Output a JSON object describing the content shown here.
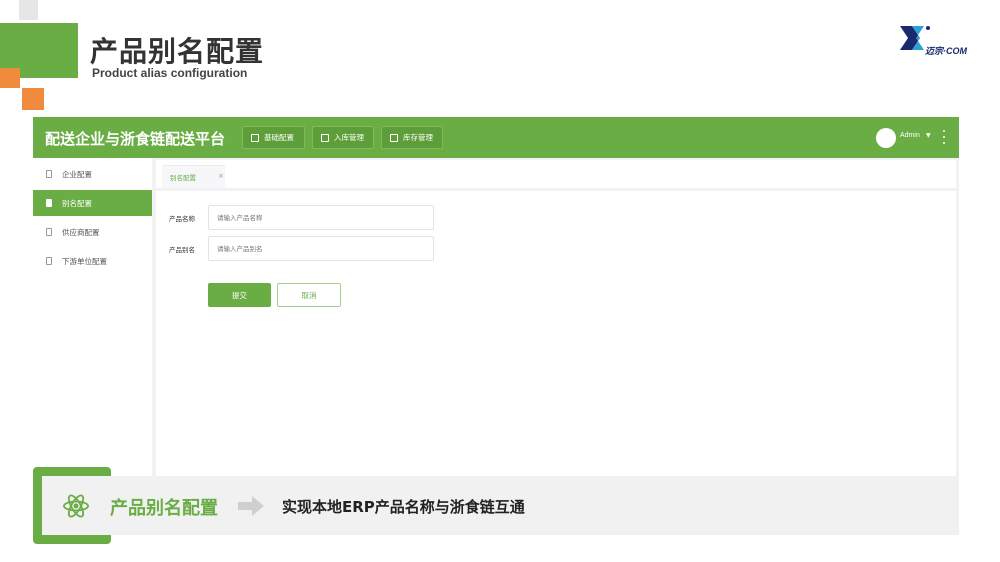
{
  "slide": {
    "title": "产品别名配置",
    "subtitle": "Product alias configuration",
    "logo_text": "迈宗·COM"
  },
  "app": {
    "title": "配送企业与浙食链配送平台",
    "nav": [
      {
        "label": "基础配置",
        "icon": "document-icon"
      },
      {
        "label": "入库管理",
        "icon": "inbox-icon"
      },
      {
        "label": "库存管理",
        "icon": "box-icon"
      }
    ],
    "user": {
      "name": "Admin",
      "caret": "▼"
    },
    "sidebar": [
      {
        "label": "企业配置",
        "active": false
      },
      {
        "label": "别名配置",
        "active": true
      },
      {
        "label": "供应商配置",
        "active": false
      },
      {
        "label": "下游单位配置",
        "active": false
      }
    ],
    "tab": {
      "label": "别名配置",
      "close": "×"
    },
    "form": {
      "name_label": "产品名称",
      "name_placeholder": "请输入产品名称",
      "alias_label": "产品别名",
      "alias_placeholder": "请输入产品别名",
      "submit_label": "提交",
      "cancel_label": "取消"
    }
  },
  "banner": {
    "title": "产品别名配置",
    "description": "实现本地ERP产品名称与浙食链互通"
  },
  "colors": {
    "primary_green": "#6aad45",
    "accent_orange": "#f08a3c",
    "logo_navy": "#1a2a6c"
  }
}
